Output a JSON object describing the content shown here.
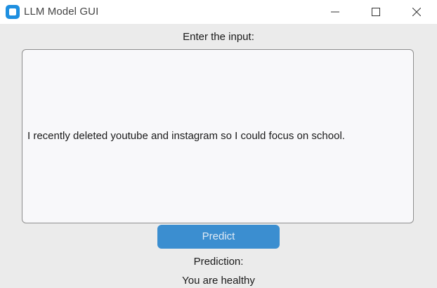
{
  "window": {
    "title": "LLM Model GUI",
    "app_icon": "app-icon",
    "controls": [
      "minimize-icon",
      "maximize-icon",
      "close-icon"
    ]
  },
  "input": {
    "label": "Enter the input:",
    "value": "I recently deleted youtube and instagram so I could focus on school."
  },
  "actions": {
    "predict_label": "Predict"
  },
  "output": {
    "label": "Prediction:",
    "value": "You are healthy"
  },
  "colors": {
    "background": "#ebebeb",
    "titlebar": "#ffffff",
    "button": "#3b8ed0",
    "textbox": "#f8f8fa",
    "border": "#8e8e8e"
  }
}
